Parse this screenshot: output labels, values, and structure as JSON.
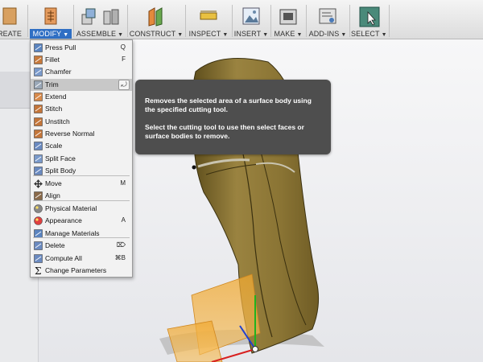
{
  "toolbar": {
    "groups": [
      {
        "label": "REATE"
      },
      {
        "label": "MODIFY"
      },
      {
        "label": "ASSEMBLE"
      },
      {
        "label": "CONSTRUCT"
      },
      {
        "label": "INSPECT"
      },
      {
        "label": "INSERT"
      },
      {
        "label": "MAKE"
      },
      {
        "label": "ADD-INS"
      },
      {
        "label": "SELECT"
      }
    ],
    "caret": "▼"
  },
  "modify_menu": {
    "items": [
      {
        "label": "Press Pull",
        "shortcut": "Q",
        "icon": "press-pull-icon"
      },
      {
        "label": "Fillet",
        "shortcut": "F",
        "icon": "fillet-icon"
      },
      {
        "label": "Chamfer",
        "shortcut": "",
        "icon": "chamfer-icon"
      },
      {
        "label": "Trim",
        "shortcut": "",
        "icon": "trim-icon"
      },
      {
        "label": "Extend",
        "shortcut": "",
        "icon": "extend-icon"
      },
      {
        "label": "Stitch",
        "shortcut": "",
        "icon": "stitch-icon"
      },
      {
        "label": "Unstitch",
        "shortcut": "",
        "icon": "unstitch-icon"
      },
      {
        "label": "Reverse Normal",
        "shortcut": "",
        "icon": "reverse-normal-icon"
      },
      {
        "label": "Scale",
        "shortcut": "",
        "icon": "scale-icon"
      },
      {
        "label": "Split Face",
        "shortcut": "",
        "icon": "split-face-icon"
      },
      {
        "label": "Split Body",
        "shortcut": "",
        "icon": "split-body-icon"
      },
      {
        "label": "Move",
        "shortcut": "M",
        "icon": "move-icon"
      },
      {
        "label": "Align",
        "shortcut": "",
        "icon": "align-icon"
      },
      {
        "label": "Physical Material",
        "shortcut": "",
        "icon": "physical-material-icon"
      },
      {
        "label": "Appearance",
        "shortcut": "A",
        "icon": "appearance-icon"
      },
      {
        "label": "Manage Materials",
        "shortcut": "",
        "icon": "manage-materials-icon"
      },
      {
        "label": "Delete",
        "shortcut": "⌦",
        "icon": "delete-icon"
      },
      {
        "label": "Compute All",
        "shortcut": "⌘B",
        "icon": "compute-all-icon"
      },
      {
        "label": "Change Parameters",
        "shortcut": "",
        "icon": "change-parameters-icon"
      }
    ],
    "highlighted": "Trim",
    "pin_glyph": "⤾"
  },
  "tooltip": {
    "line1": "Removes the selected area of a surface body using the specified cutting tool.",
    "line2": "Select the cutting tool to use then select faces or surface bodies to remove."
  },
  "colors": {
    "accent": "#2f6fc4",
    "surface_body": "#8a7434",
    "tooltip_bg": "#4e4e4e"
  }
}
